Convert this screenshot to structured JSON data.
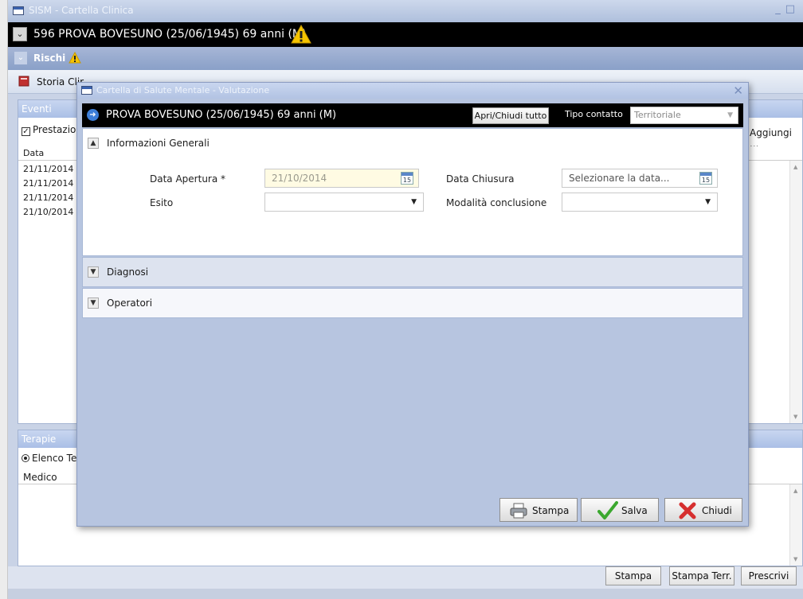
{
  "app": {
    "window_title": "SISM - Cartella Clinica",
    "patient_header": "596 PROVA BOVESUNO (25/06/1945) 69 anni (M)",
    "rischi_label": "Rischi",
    "toolbar": {
      "storia_label": "Storia Clir"
    }
  },
  "eventi": {
    "title": "Eventi",
    "filter_label": "Prestazion",
    "aggiungi_label": "Aggiungi ...",
    "column_data": "Data",
    "rows": [
      "21/11/2014",
      "21/11/2014",
      "21/11/2014",
      "21/10/2014"
    ]
  },
  "terapie": {
    "title": "Terapie",
    "filter_label": "Elenco Ter",
    "column_medico": "Medico"
  },
  "bottom": {
    "stampa_label": "Stampa",
    "stampa_terr_label": "Stampa Terr.",
    "prescrivi_label": "Prescrivi"
  },
  "modal": {
    "title": "Cartella di Salute Mentale - Valutazione",
    "patient": "PROVA BOVESUNO (25/06/1945) 69 anni (M)",
    "apri_chiudi_label": "Apri/Chiudi tutto",
    "tipo_contatto_label": "Tipo contatto",
    "tipo_contatto_value": "Territoriale",
    "sections": {
      "info": {
        "title": "Informazioni Generali",
        "data_apertura_label": "Data Apertura *",
        "data_apertura_value": "21/10/2014",
        "data_chiusura_label": "Data Chiusura",
        "data_chiusura_placeholder": "Selezionare la data...",
        "calendar_day": "15",
        "esito_label": "Esito",
        "esito_value": "",
        "modalita_label": "Modalità conclusione",
        "modalita_value": ""
      },
      "diagnosi": {
        "title": "Diagnosi"
      },
      "operatori": {
        "title": "Operatori"
      }
    },
    "buttons": {
      "stampa": "Stampa",
      "salva": "Salva",
      "chiudi": "Chiudi"
    }
  },
  "colors": {
    "titlebar": "#aebfdc",
    "header_black": "#000000",
    "panel_header": "#aabfe6",
    "modal_body": "#b7c5e0",
    "warning_yellow": "#f5c400",
    "disabled_field": "#fffbe3"
  }
}
